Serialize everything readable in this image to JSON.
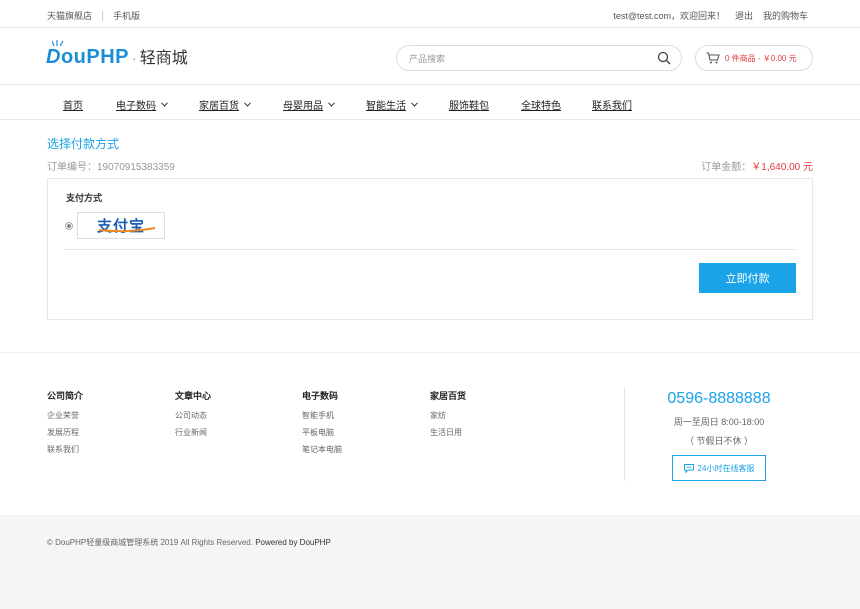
{
  "topbar": {
    "store_link": "天猫旗舰店",
    "mobile_link": "手机版",
    "welcome": "test@test.com，欢迎回来！",
    "logout": "退出",
    "my_cart": "我的购物车"
  },
  "header": {
    "logo_brand_d": "D",
    "logo_brand_rest": "ouPHP",
    "logo_dot": "·",
    "logo_sub": "轻商城",
    "search_placeholder": "产品搜索",
    "cart_text": "0 件商品 - ￥0.00 元"
  },
  "nav": {
    "items": [
      {
        "label": "首页",
        "dropdown": false
      },
      {
        "label": "电子数码",
        "dropdown": true
      },
      {
        "label": "家居百货",
        "dropdown": true
      },
      {
        "label": "母婴用品",
        "dropdown": true
      },
      {
        "label": "智能生活",
        "dropdown": true
      },
      {
        "label": "服饰鞋包",
        "dropdown": false
      },
      {
        "label": "全球特色",
        "dropdown": false
      },
      {
        "label": "联系我们",
        "dropdown": false
      }
    ]
  },
  "main": {
    "title": "选择付款方式",
    "order_no": "订单编号：19070915383359",
    "amount_label": "订单金额：",
    "amount_value": "￥1,640.00 元",
    "pay_method_title": "支付方式",
    "alipay_text": "支付宝",
    "pay_button": "立即付款"
  },
  "footer": {
    "columns": [
      {
        "title": "公司简介",
        "links": [
          "企业荣誉",
          "发展历程",
          "联系我们"
        ]
      },
      {
        "title": "文章中心",
        "links": [
          "公司动态",
          "行业新闻"
        ]
      },
      {
        "title": "电子数码",
        "links": [
          "智能手机",
          "平板电脑",
          "笔记本电脑"
        ]
      },
      {
        "title": "家居百货",
        "links": [
          "家纺",
          "生活日用"
        ]
      }
    ],
    "phone": "0596-8888888",
    "hours": "周一至周日 8:00-18:00",
    "hours_note": "（ 节假日不休 ）",
    "service_button": "24小时在线客服",
    "copyright": "© DouPHP轻量级商城管理系统 2019 All Rights Reserved.",
    "powered": "Powered by DouPHP"
  },
  "colors": {
    "accent": "#1aa3e8",
    "price_red": "#e4393c",
    "logo_blue": "#1a8fd6"
  }
}
